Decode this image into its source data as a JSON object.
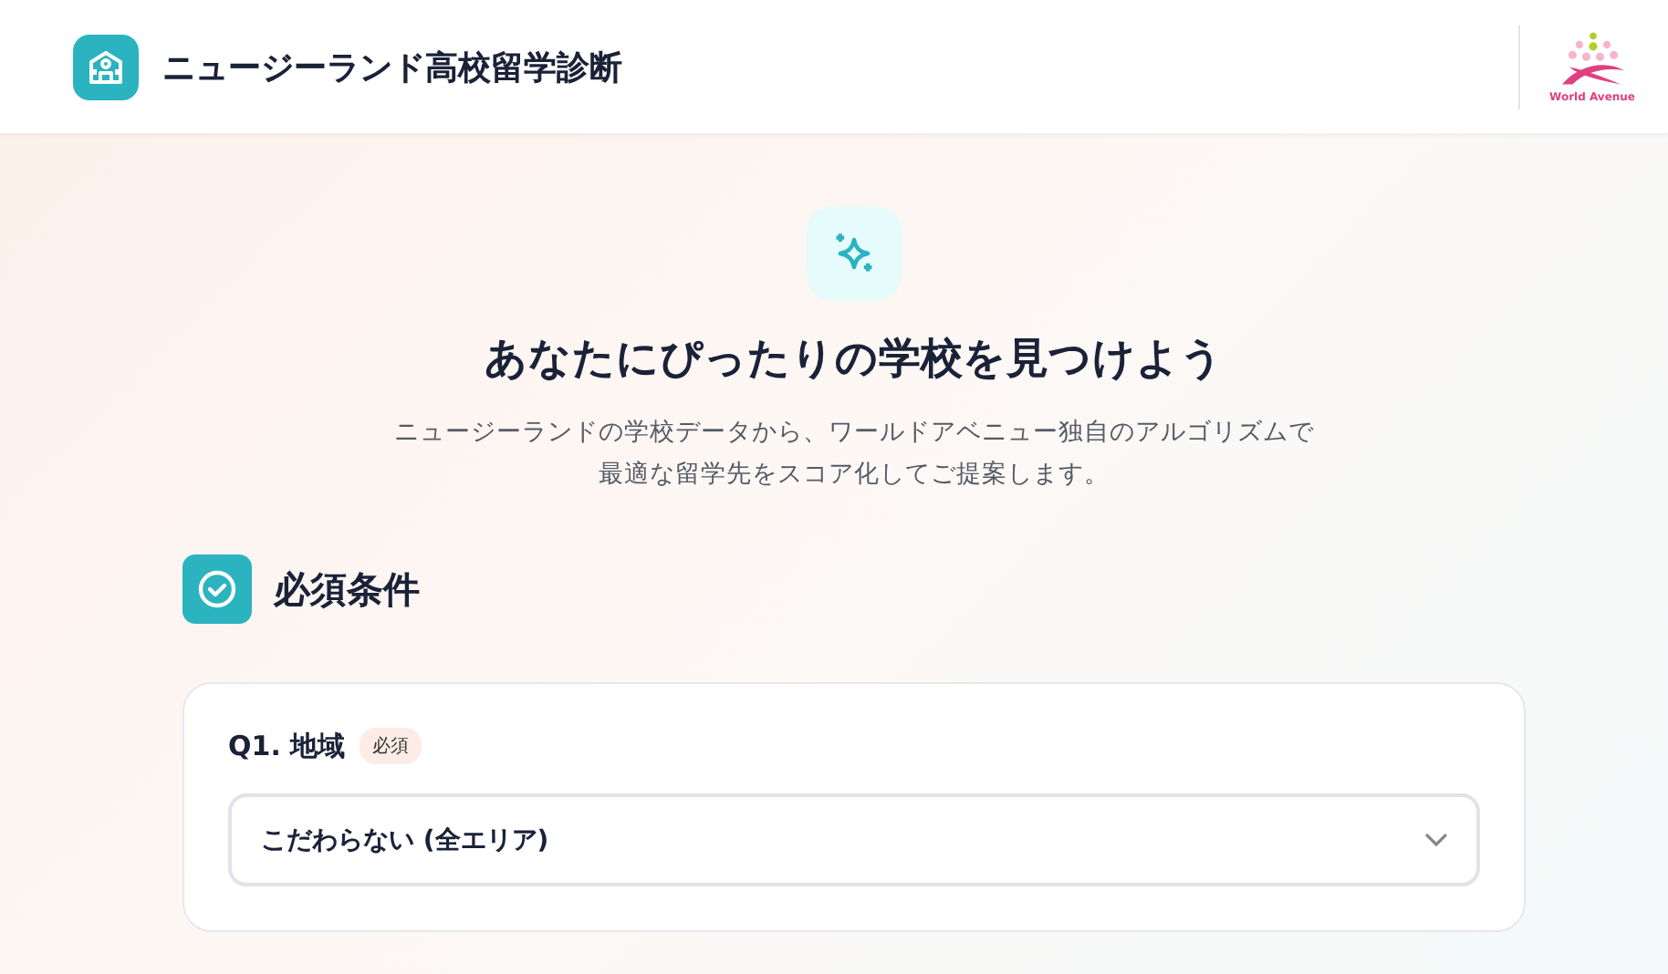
{
  "header": {
    "title": "ニュージーランド高校留学診断",
    "logo_text": "World Avenue"
  },
  "hero": {
    "title": "あなたにぴったりの学校を見つけよう",
    "description_lines": [
      "ニュージーランドの学校データから、ワールドアベニュー独自のアルゴリズムで",
      "最適な留学先をスコア化してご提案します。"
    ]
  },
  "section": {
    "title": "必須条件"
  },
  "questions": [
    {
      "label": "Q1. 地域",
      "badge": "必須",
      "kind": "select",
      "value": "こだわらない (全エリア)"
    }
  ]
}
